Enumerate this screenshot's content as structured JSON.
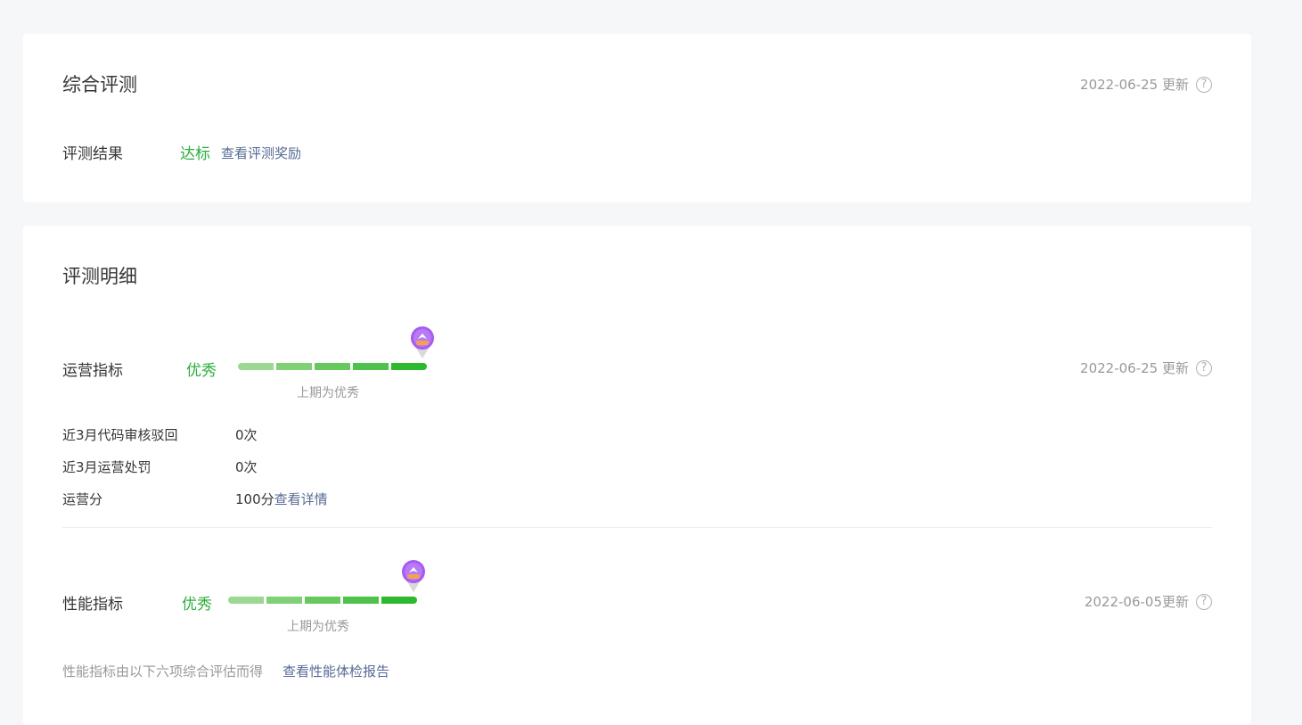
{
  "overall": {
    "title": "综合评测",
    "updated": "2022-06-25 更新",
    "result_label": "评测结果",
    "result_value": "达标",
    "reward_link": "查看评测奖励"
  },
  "detail": {
    "title": "评测明细",
    "operation": {
      "label": "运营指标",
      "level": "优秀",
      "previous": "上期为优秀",
      "updated": "2022-06-25 更新",
      "level_index": 5,
      "rows": [
        {
          "label": "近3月代码审核驳回",
          "value": "0次"
        },
        {
          "label": "近3月运营处罚",
          "value": "0次"
        },
        {
          "label": "运营分",
          "value": "100分",
          "link": "查看详情"
        }
      ]
    },
    "performance": {
      "label": "性能指标",
      "level": "优秀",
      "previous": "上期为优秀",
      "updated": "2022-06-05更新",
      "level_index": 5,
      "note": "性能指标由以下六项综合评估而得",
      "report_link": "查看性能体检报告"
    }
  },
  "colors": {
    "green_text": "#2aae3b",
    "link": "#576b95",
    "bar_segments": [
      "#9cd894",
      "#80d076",
      "#66c85d",
      "#4ec24a",
      "#2db92d"
    ],
    "pin_purple": "#a65bf2",
    "pin_orange": "#f5a053"
  },
  "icons": {
    "help": "question-circle-icon",
    "pin": "badge-pin-icon"
  },
  "help_glyph": "?"
}
